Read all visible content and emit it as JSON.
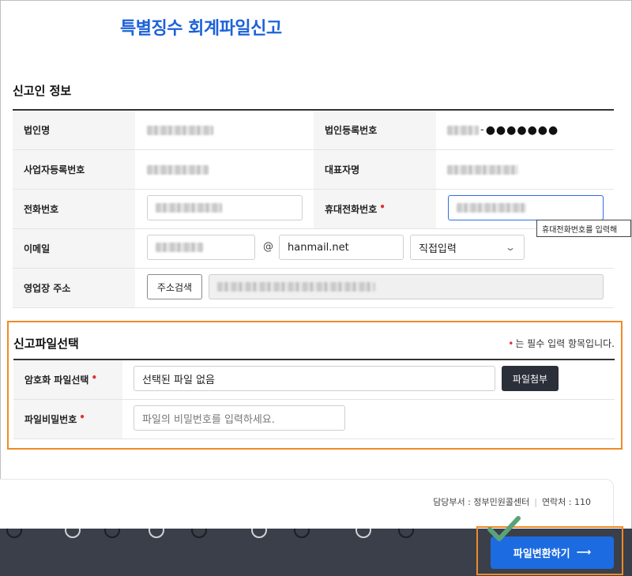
{
  "page_title": "특별징수 회계파일신고",
  "reporter_section": {
    "title": "신고인 정보",
    "rows": [
      {
        "label_left": "법인명",
        "label_right": "법인등록번호",
        "right_masked_suffix": "●●●●●●●"
      },
      {
        "label_left": "사업자등록번호",
        "label_right": "대표자명"
      },
      {
        "label_left": "전화번호",
        "label_right": "휴대전화번호"
      },
      {
        "label_left": "이메일"
      },
      {
        "label_left": "영업장 주소"
      }
    ],
    "email_at": "@",
    "email_domain": "hanmail.net",
    "email_select": "직접입력",
    "address_button": "주소검색",
    "mobile_tooltip": "휴대전화번호를 입력해"
  },
  "file_section": {
    "title": "신고파일선택",
    "required_dot": "•",
    "required_note": "는 필수 입력 항목입니다.",
    "encrypted_file_label": "암호화 파일선택",
    "file_input_value": "선택된 파일 없음",
    "attach_button": "파일첨부",
    "password_label": "파일비밀번호",
    "password_placeholder": "파일의 비밀번호를 입력하세요."
  },
  "footer": {
    "department": "담당부서 : 정부민원콜센터",
    "contact": "연락처 : 110",
    "separator": "|"
  },
  "convert_button": {
    "label": "파일변환하기",
    "arrow": "⟶"
  },
  "colors": {
    "accent": "#1d6be0",
    "highlight": "#f08a25",
    "check": "#5aa37a"
  }
}
